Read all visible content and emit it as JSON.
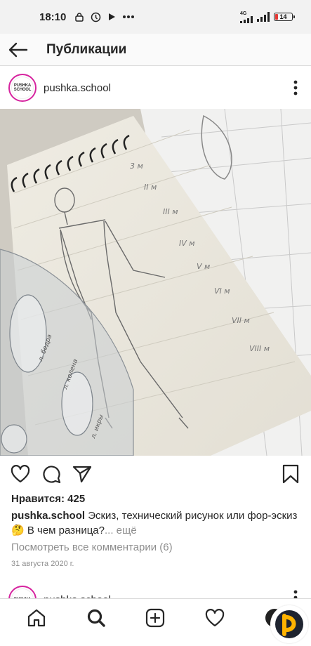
{
  "status_bar": {
    "time": "18:10",
    "network_label": "4G",
    "battery_level": "14",
    "battery_color": "#e53935"
  },
  "header": {
    "back_icon": "arrow-left-icon",
    "title": "Публикации"
  },
  "post": {
    "avatar_text": "PUSHKA SCHOOL",
    "username": "pushka.school",
    "menu_icon": "more-vertical-icon",
    "image_description_icon": "fashion-sketch-photo",
    "actions": {
      "like_icon": "heart-icon",
      "comment_icon": "comment-icon",
      "share_icon": "send-icon",
      "save_icon": "bookmark-icon"
    },
    "likes_text": "Нравится: 425",
    "caption_user": "pushka.school",
    "caption_text": "Эскиз, технический рисунок или фор-эскиз 🤔 В чем разница?",
    "caption_more": "... ещё",
    "comments_link": "Посмотреть все комментарии (6)",
    "date": "31 августа 2020 г."
  },
  "next_post": {
    "avatar_text": "PUSHKA",
    "username": "pushka.school"
  },
  "bottom_nav": {
    "items": [
      "home-icon",
      "search-icon",
      "add-icon",
      "activity-heart-icon",
      "profile-avatar"
    ]
  },
  "accent_color": "#d6249f"
}
